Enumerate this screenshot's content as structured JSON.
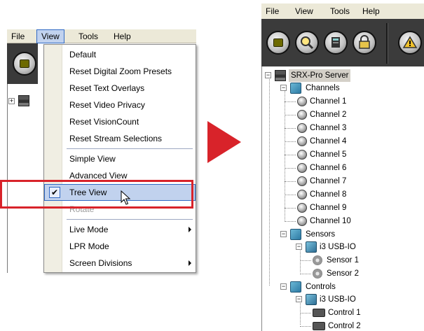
{
  "left": {
    "menubar": [
      "File",
      "View",
      "Tools",
      "Help"
    ],
    "active_menu": "View",
    "view_menu": {
      "items": [
        {
          "label": "Default"
        },
        {
          "label": "Reset Digital Zoom Presets"
        },
        {
          "label": "Reset Text Overlays"
        },
        {
          "label": "Reset Video Privacy"
        },
        {
          "label": "Reset VisionCount"
        },
        {
          "label": "Reset Stream Selections"
        },
        {
          "label": "Simple View"
        },
        {
          "label": "Advanced View"
        },
        {
          "label": "Tree View",
          "checked": true,
          "selected": true
        },
        {
          "label": "Rotate",
          "disabled": true
        },
        {
          "label": "Live Mode",
          "submenu": true
        },
        {
          "label": "LPR Mode"
        },
        {
          "label": "Screen Divisions",
          "submenu": true
        }
      ]
    }
  },
  "right": {
    "menubar": [
      "File",
      "View",
      "Tools",
      "Help"
    ],
    "tree": {
      "root": "SRX-Pro Server",
      "channels_label": "Channels",
      "channels": [
        "Channel 1",
        "Channel 2",
        "Channel 3",
        "Channel 4",
        "Channel 5",
        "Channel 6",
        "Channel 7",
        "Channel 8",
        "Channel 9",
        "Channel 10"
      ],
      "sensors_label": "Sensors",
      "sensors_device": "i3 USB-IO",
      "sensors": [
        "Sensor 1",
        "Sensor 2"
      ],
      "controls_label": "Controls",
      "controls_device": "i3 USB-IO",
      "controls": [
        "Control 1",
        "Control 2"
      ]
    }
  },
  "colors": {
    "highlight": "#d8232a",
    "menu_selection": "#c1d2ee",
    "menu_selection_border": "#316ac5",
    "toolbar_bg": "#3b3b3b"
  },
  "icons": [
    "camera-icon",
    "search-icon",
    "server-icon",
    "lock-icon",
    "warning-icon",
    "folder-icon",
    "light-bulb-icon",
    "sensor-icon",
    "control-icon",
    "check-icon",
    "cursor-icon",
    "arrow-right-icon"
  ]
}
